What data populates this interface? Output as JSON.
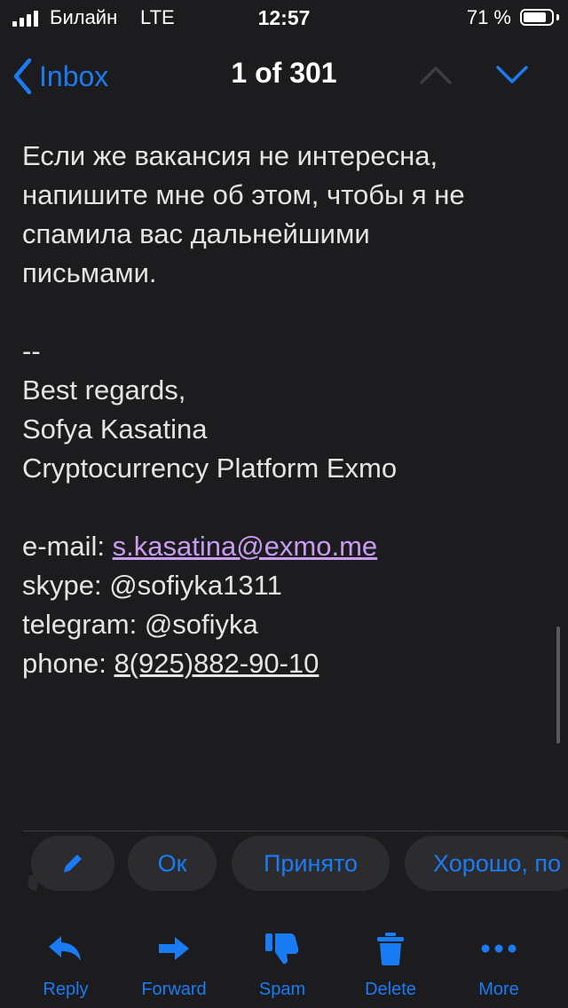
{
  "status_bar": {
    "carrier": "Билайн",
    "network": "LTE",
    "time": "12:57",
    "battery": "71 %"
  },
  "nav": {
    "back_label": "Inbox",
    "title": "1 of 301"
  },
  "message": {
    "paragraph": [
      "Если же вакансия не интересна,",
      "напишите мне об этом, чтобы я не",
      "спамила вас дальнейшими",
      "письмами."
    ],
    "signature": [
      "--",
      "Best regards,",
      "Sofya Kasatina",
      "Cryptocurrency Platform Exmo"
    ],
    "email_label": "e-mail: ",
    "email": "s.kasatina@exmo.me",
    "skype": "skype: @sofiyka1311",
    "telegram": "telegram: @sofiyka",
    "phone_label": "phone: ",
    "phone": "8(925)882-90-10"
  },
  "smart_replies": [
    "Ок",
    "Принято",
    "Хорошо, по"
  ],
  "toolbar": {
    "reply": "Reply",
    "forward": "Forward",
    "spam": "Spam",
    "delete": "Delete",
    "more": "More"
  },
  "colors": {
    "background": "#1c1c1e",
    "accent": "#1a7cf5",
    "link": "#c99bf1",
    "chip": "#2c2c2e"
  }
}
